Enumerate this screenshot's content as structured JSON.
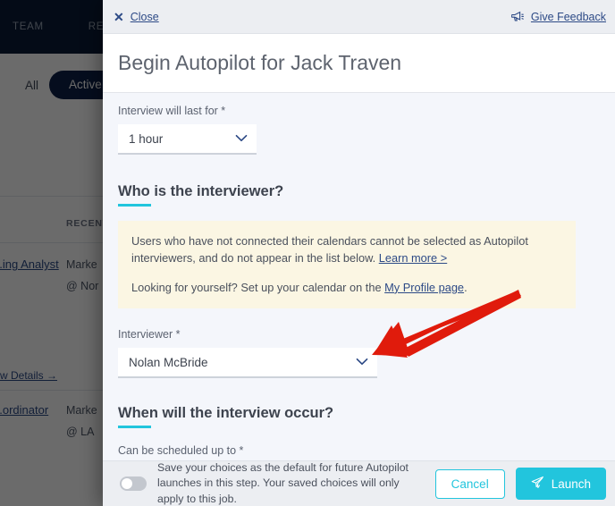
{
  "background": {
    "nav_items": [
      "TEAM",
      "REPORTS"
    ],
    "filters": {
      "all_label": "All",
      "active_label": "Active"
    },
    "column_header": "RECENT",
    "rows": [
      {
        "title": "...ing Analyst",
        "company": "Marke",
        "location": "@ Nor",
        "view_details": "...w Details →"
      },
      {
        "title": "...ordinator",
        "company": "Marke",
        "location": "@ LA "
      }
    ]
  },
  "modal": {
    "topbar": {
      "close_label": "Close",
      "close_icon": "close-x-icon",
      "feedback_label": "Give Feedback",
      "feedback_icon": "megaphone-icon"
    },
    "title": "Begin Autopilot for Jack Traven",
    "duration": {
      "label": "Interview will last for *",
      "value": "1 hour",
      "caret_icon": "chevron-down-icon"
    },
    "interviewer_section": {
      "heading": "Who is the interviewer?",
      "notice_line1": "Users who have not connected their calendars cannot be selected as Autopilot interviewers, and do not appear in the list below.",
      "notice_link1": "Learn more >",
      "notice_line2_before": "Looking for yourself? Set up your calendar on the ",
      "notice_link2": "My Profile page",
      "notice_line2_after": ".",
      "field_label": "Interviewer *",
      "field_value": "Nolan McBride",
      "caret_icon": "chevron-down-icon"
    },
    "schedule_section": {
      "heading": "When will the interview occur?",
      "field_label": "Can be scheduled up to *"
    },
    "footer": {
      "toggle_state": "off",
      "toggle_text": "Save your choices as the default for future Autopilot launches in this step. Your saved choices will only apply to this job.",
      "cancel_label": "Cancel",
      "launch_label": "Launch",
      "launch_icon": "paper-plane-icon"
    }
  },
  "annotation": {
    "arrow_color": "#e01b0c",
    "arrow_target": "interviewer-dropdown-chevron"
  },
  "colors": {
    "accent_cyan": "#22c5dd",
    "link_blue": "#2d4a86",
    "nav_navy": "#0b1c38",
    "notice_bg": "#fbf6e3"
  }
}
